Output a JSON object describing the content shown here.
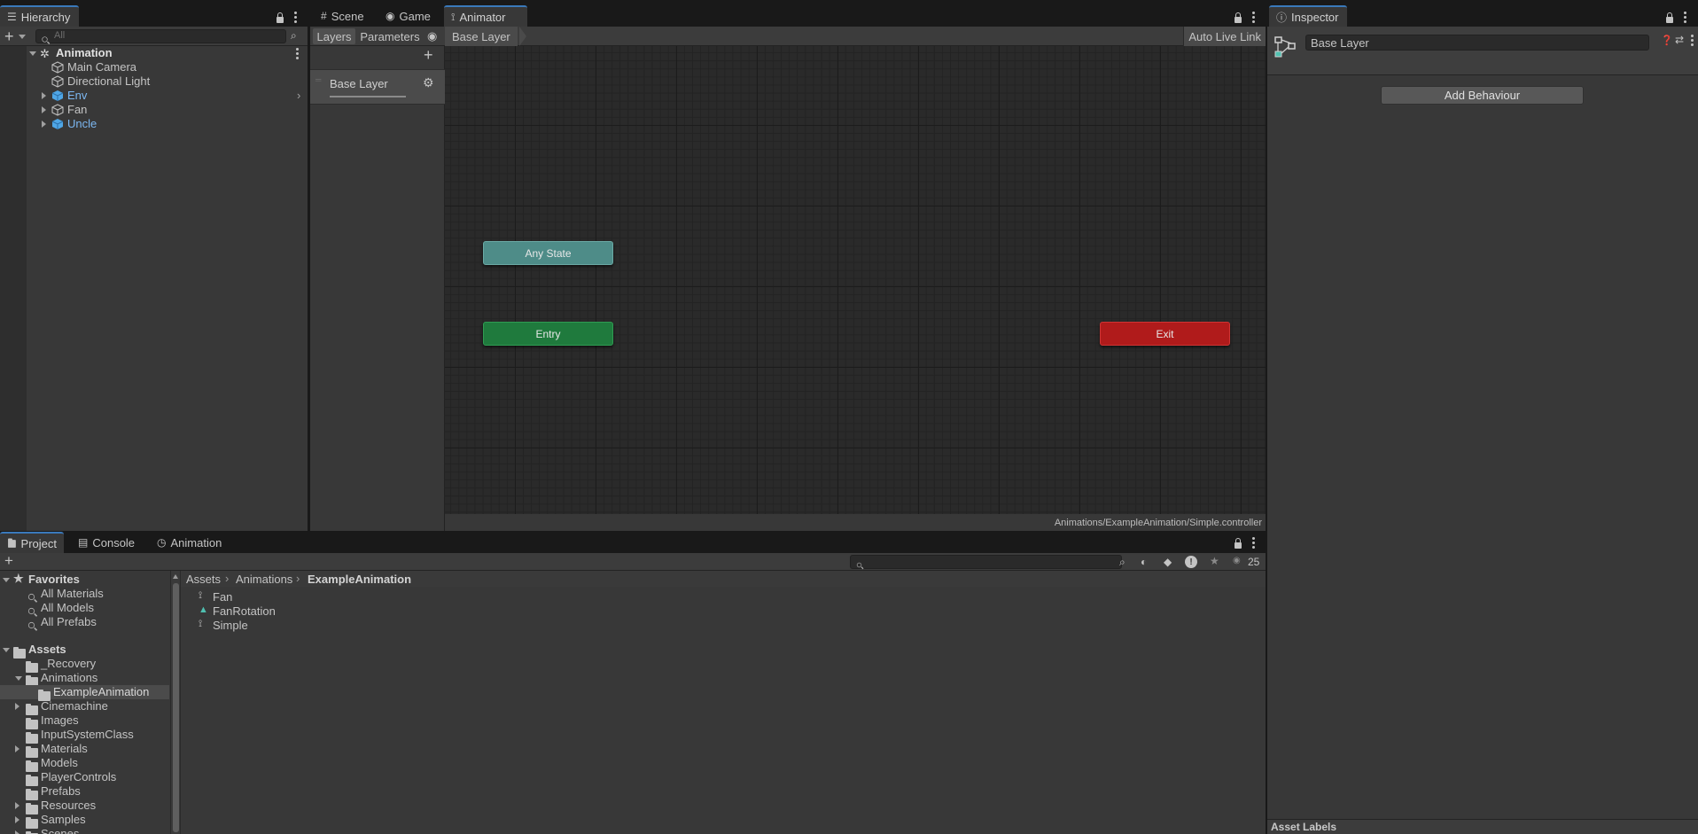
{
  "hierarchy": {
    "tab": "Hierarchy",
    "search_placeholder": "All",
    "scene": "Animation",
    "items": [
      {
        "label": "Main Camera"
      },
      {
        "label": "Directional Light"
      },
      {
        "label": "Env"
      },
      {
        "label": "Fan"
      },
      {
        "label": "Uncle"
      }
    ]
  },
  "center_tabs": {
    "scene": "Scene",
    "game": "Game",
    "animator": "Animator"
  },
  "animator": {
    "layers_tab": "Layers",
    "parameters_tab": "Parameters",
    "breadcrumb": "Base Layer",
    "auto_live_link": "Auto Live Link",
    "layer_name": "Base Layer",
    "nodes": {
      "any_state": "Any State",
      "entry": "Entry",
      "exit": "Exit"
    },
    "controller_path": "Animations/ExampleAnimation/Simple.controller"
  },
  "inspector": {
    "tab": "Inspector",
    "name": "Base Layer",
    "add_behaviour": "Add Behaviour",
    "asset_labels": "Asset Labels"
  },
  "bottom_tabs": {
    "project": "Project",
    "console": "Console",
    "animation": "Animation"
  },
  "project": {
    "favorites": {
      "label": "Favorites",
      "items": [
        {
          "label": "All Materials"
        },
        {
          "label": "All Models"
        },
        {
          "label": "All Prefabs"
        }
      ]
    },
    "assets": {
      "label": "Assets",
      "folders": [
        {
          "label": "_Recovery"
        },
        {
          "label": "Animations"
        },
        {
          "label": "ExampleAnimation"
        },
        {
          "label": "Cinemachine"
        },
        {
          "label": "Images"
        },
        {
          "label": "InputSystemClass"
        },
        {
          "label": "Materials"
        },
        {
          "label": "Models"
        },
        {
          "label": "PlayerControls"
        },
        {
          "label": "Prefabs"
        },
        {
          "label": "Resources"
        },
        {
          "label": "Samples"
        },
        {
          "label": "Scenes"
        }
      ]
    },
    "breadcrumb": [
      "Assets",
      "Animations",
      "ExampleAnimation"
    ],
    "files": [
      {
        "label": "Fan"
      },
      {
        "label": "FanRotation"
      },
      {
        "label": "Simple"
      }
    ],
    "hidden_count": "25"
  },
  "colors": {
    "accent": "#3a79bb",
    "any_state": "#4e8c88",
    "entry": "#1f7a3d",
    "exit": "#b01b1b",
    "prefab_blue": "#7cb7f1"
  }
}
